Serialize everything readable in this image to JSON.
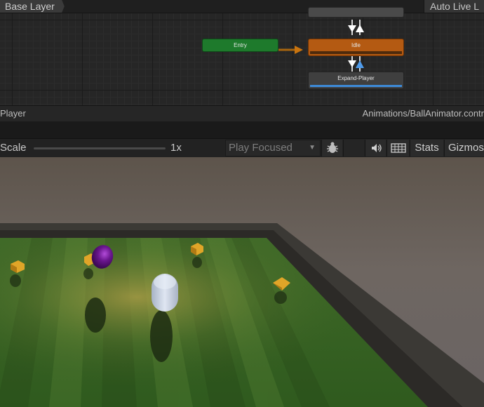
{
  "animator": {
    "layer_tab": "Base Layer",
    "auto_live_label": "Auto Live L",
    "states": {
      "entry": "Entry",
      "idle": "Idle",
      "expand": "Expand-Player"
    },
    "status_left": "Player",
    "status_right": "Animations/BallAnimator.contr"
  },
  "game_toolbar": {
    "scale_label": "Scale",
    "scale_value": "1x",
    "play_mode": "Play Focused",
    "stats_label": "Stats",
    "gizmos_label": "Gizmos"
  },
  "colors": {
    "entry_state": "#1e7a2c",
    "idle_state": "#b45a12",
    "transition_blue": "#3d8ad8",
    "field_grass": "#4a7a2a",
    "wall": "#3b3935",
    "player_capsule": "#c9d3e4",
    "enemy_ball": "#6a168e",
    "pickup_cube": "#e0a528"
  },
  "icons": {
    "bug": "bug-icon",
    "audio": "speaker-icon",
    "keyboard": "keyboard-icon",
    "dropdown": "chevron-down-icon"
  }
}
